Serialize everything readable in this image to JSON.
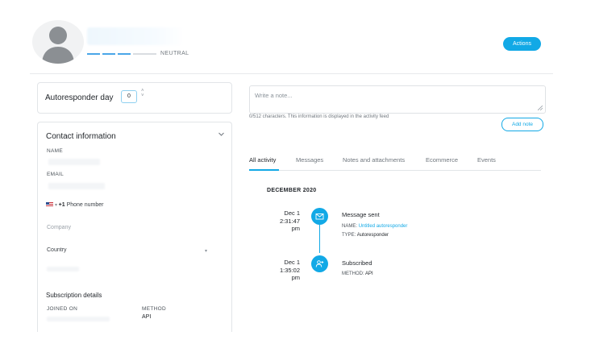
{
  "header": {
    "sentiment_label": "NEUTRAL",
    "actions_label": "Actions"
  },
  "autoresponder": {
    "label": "Autoresponder day",
    "day_value": "0"
  },
  "contact": {
    "title": "Contact information",
    "name_label": "NAME",
    "email_label": "EMAIL",
    "phone_code": "+1",
    "phone_placeholder": "Phone number",
    "company_placeholder": "Company",
    "country_label": "Country",
    "subscription_title": "Subscription details",
    "joined_on_label": "JOINED ON",
    "method_label": "METHOD",
    "method_value": "API"
  },
  "note": {
    "placeholder": "Write a note...",
    "help_text": "0/512 characters. This information is displayed in the activity feed",
    "add_label": "Add note"
  },
  "tabs": [
    {
      "label": "All activity",
      "active": true
    },
    {
      "label": "Messages",
      "active": false
    },
    {
      "label": "Notes and attachments",
      "active": false
    },
    {
      "label": "Ecommerce",
      "active": false
    },
    {
      "label": "Events",
      "active": false
    }
  ],
  "activity": {
    "month": "DECEMBER 2020",
    "events": [
      {
        "date_line1": "Dec 1",
        "date_line2": "2:31:47",
        "date_line3": "pm",
        "icon": "envelope-icon",
        "title": "Message sent",
        "meta1_key": "NAME:",
        "meta1_value": "Untitled autoresponder",
        "meta2_key": "TYPE:",
        "meta2_value": "Autoresponder"
      },
      {
        "date_line1": "Dec 1",
        "date_line2": "1:35:02",
        "date_line3": "pm",
        "icon": "user-plus-icon",
        "title": "Subscribed",
        "meta1_key": "METHOD:",
        "meta1_value": "API"
      }
    ]
  },
  "colors": {
    "accent": "#12a9e6",
    "border": "#e2e5e8",
    "text": "#1f2328"
  }
}
